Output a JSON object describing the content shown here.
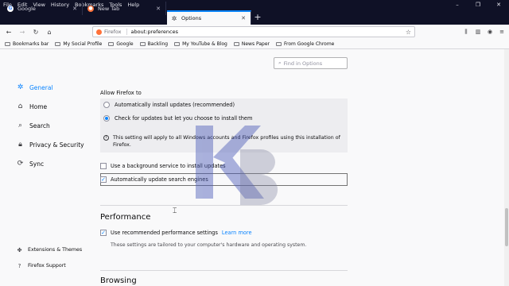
{
  "menu": [
    "File",
    "Edit",
    "View",
    "History",
    "Bookmarks",
    "Tools",
    "Help"
  ],
  "window_controls": [
    "–",
    "❐",
    "✕"
  ],
  "tabs": [
    {
      "label": "Google",
      "icon": "google-icon"
    },
    {
      "label": "New Tab",
      "icon": "firefox-icon"
    },
    {
      "label": "Options",
      "icon": "gear-icon",
      "active": true
    }
  ],
  "new_tab_symbol": "+",
  "nav": {
    "identity_label": "Firefox",
    "url": "about:preferences"
  },
  "bookmarks": [
    "Bookmarks bar",
    "My Social Profile",
    "Google",
    "Backling",
    "My YouTube & Blog",
    "News Paper",
    "From Google Chrome"
  ],
  "search": {
    "placeholder": "Find in Options"
  },
  "sidebar": {
    "items": [
      {
        "label": "General",
        "icon": "gear-icon",
        "selected": true
      },
      {
        "label": "Home",
        "icon": "home-icon"
      },
      {
        "label": "Search",
        "icon": "search-icon"
      },
      {
        "label": "Privacy & Security",
        "icon": "lock-icon"
      },
      {
        "label": "Sync",
        "icon": "sync-icon"
      }
    ],
    "footer": [
      {
        "label": "Extensions & Themes",
        "icon": "puzzle-icon"
      },
      {
        "label": "Firefox Support",
        "icon": "help-icon"
      }
    ]
  },
  "updates": {
    "heading": "Allow Firefox to",
    "options": [
      {
        "label": "Automatically install updates (recommended)",
        "checked": false
      },
      {
        "label": "Check for updates but let you choose to install them",
        "checked": true
      }
    ],
    "info": "This setting will apply to all Windows accounts and Firefox profiles using this installation of Firefox."
  },
  "checkboxes": [
    {
      "label": "Use a background service to install updates",
      "checked": false
    },
    {
      "label": "Automatically update search engines",
      "checked": true
    }
  ],
  "performance": {
    "title": "Performance",
    "recommended_label": "Use recommended performance settings",
    "recommended_checked": true,
    "learn_more": "Learn more",
    "description": "These settings are tailored to your computer's hardware and operating system."
  },
  "browsing": {
    "title": "Browsing"
  },
  "watermark_text": "KB",
  "colors": {
    "accent": "#0a84ff",
    "titlebar": "#0f1126",
    "watermark": "#4a5ab8"
  }
}
